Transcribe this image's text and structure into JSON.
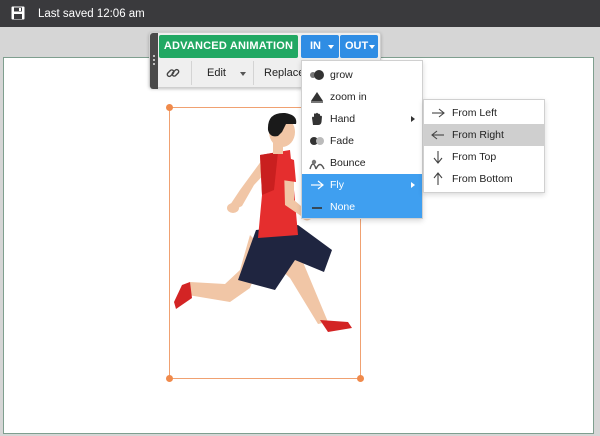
{
  "topbar": {
    "save_icon": "floppy-disk-icon",
    "saved_text": "Last saved 12:06 am"
  },
  "toolbar": {
    "advanced_animation_label": "ADVANCED ANIMATION",
    "in_label": "IN",
    "out_label": "OUT",
    "link_icon": "link-icon",
    "edit_label": "Edit",
    "replace_label": "Replace"
  },
  "animation_menu": {
    "items": [
      {
        "label": "grow",
        "icon": "grow-icon"
      },
      {
        "label": "zoom in",
        "icon": "zoom-in-icon"
      },
      {
        "label": "Hand",
        "icon": "hand-icon",
        "has_submenu": true
      },
      {
        "label": "Fade",
        "icon": "fade-icon"
      },
      {
        "label": "Bounce",
        "icon": "bounce-icon"
      },
      {
        "label": "Fly",
        "icon": "arrow-right-icon",
        "has_submenu": true,
        "active": true
      },
      {
        "label": "None",
        "icon": "dash-icon"
      }
    ]
  },
  "fly_submenu": {
    "items": [
      {
        "label": "From Left",
        "icon": "arrow-right-icon"
      },
      {
        "label": "From Right",
        "icon": "arrow-left-icon",
        "hover": true
      },
      {
        "label": "From Top",
        "icon": "arrow-down-icon"
      },
      {
        "label": "From Bottom",
        "icon": "arrow-up-icon"
      }
    ]
  },
  "colors": {
    "topbar": "#3a3a3d",
    "advanced_button": "#21a863",
    "in_out_buttons": "#2f8de4",
    "menu_active": "#3f9ff0",
    "submenu_hover": "#cfcfcf",
    "selection": "#f08a4b"
  }
}
